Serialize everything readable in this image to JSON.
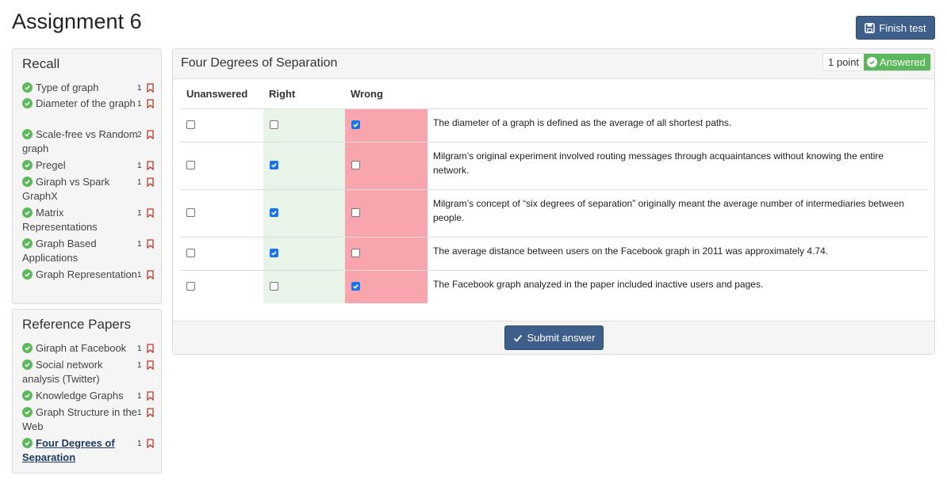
{
  "page": {
    "title": "Assignment 6"
  },
  "header": {
    "finish_label": "Finish test"
  },
  "recall": {
    "title": "Recall",
    "items": [
      {
        "label": "Type of graph",
        "points": "1"
      },
      {
        "label": "Diameter of the graph",
        "points": "1"
      },
      {
        "label": "Scale-free vs Random graph",
        "points": "2"
      },
      {
        "label": "Pregel",
        "points": "1"
      },
      {
        "label": "Giraph vs Spark GraphX",
        "points": "1"
      },
      {
        "label": "Matrix Representations",
        "points": "1"
      },
      {
        "label": "Graph Based Applications",
        "points": "1"
      },
      {
        "label": "Graph Representation",
        "points": "1"
      }
    ]
  },
  "references": {
    "title": "Reference Papers",
    "items": [
      {
        "label": "Giraph at Facebook",
        "points": "1"
      },
      {
        "label": "Social network analysis (Twitter)",
        "points": "1"
      },
      {
        "label": "Knowledge Graphs",
        "points": "1"
      },
      {
        "label": "Graph Structure in the Web",
        "points": "1"
      },
      {
        "label": "Four Degrees of Separation",
        "points": "1",
        "active": true
      }
    ]
  },
  "question": {
    "title": "Four Degrees of Separation",
    "points_label": "1 point",
    "status_label": "Answered",
    "columns": [
      "Unanswered",
      "Right",
      "Wrong"
    ],
    "rows": [
      {
        "statement": "The diameter of a graph is defined as the average of all shortest paths.",
        "selected": "Wrong"
      },
      {
        "statement": "Milgram’s original experiment involved routing messages through acquaintances without knowing the entire network.",
        "selected": "Right"
      },
      {
        "statement": "Milgram’s concept of “six degrees of separation” originally meant the average number of intermediaries between people.",
        "selected": "Right"
      },
      {
        "statement": "The average distance between users on the Facebook graph in 2011 was approximately 4.74.",
        "selected": "Right"
      },
      {
        "statement": "The Facebook graph analyzed in the paper included inactive users and pages.",
        "selected": "Wrong"
      }
    ],
    "submit_label": "Submit answer"
  },
  "colors": {
    "accent": "#3e5f8a",
    "success": "#5cb85c",
    "right_bg": "#e8f4e8",
    "wrong_bg": "#f8a5ae",
    "checkbox": "#1a73e8"
  },
  "icons": {
    "finish": "save-icon",
    "answered": "check-circle-icon",
    "submit": "check-icon",
    "item_status": "check-circle-icon",
    "bookmark": "bookmark-icon"
  }
}
